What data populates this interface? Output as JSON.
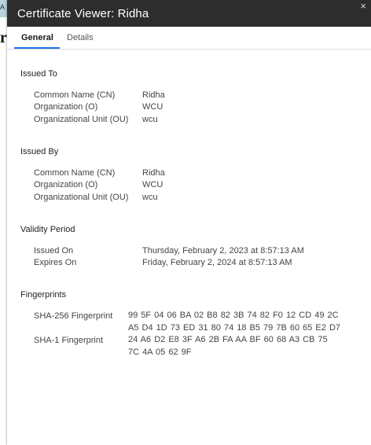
{
  "background": {
    "top_label": "A",
    "glyph": "r"
  },
  "window": {
    "title": "Certificate Viewer: Ridha",
    "close_glyph": "×"
  },
  "tabs": [
    {
      "label": "General",
      "active": true
    },
    {
      "label": "Details",
      "active": false
    }
  ],
  "issued_to": {
    "title": "Issued To",
    "fields": [
      {
        "label": "Common Name (CN)",
        "value": "Ridha"
      },
      {
        "label": "Organization (O)",
        "value": "WCU"
      },
      {
        "label": "Organizational Unit (OU)",
        "value": "wcu"
      }
    ]
  },
  "issued_by": {
    "title": "Issued By",
    "fields": [
      {
        "label": "Common Name (CN)",
        "value": "Ridha"
      },
      {
        "label": "Organization (O)",
        "value": "WCU"
      },
      {
        "label": "Organizational Unit (OU)",
        "value": "wcu"
      }
    ]
  },
  "validity": {
    "title": "Validity Period",
    "fields": [
      {
        "label": "Issued On",
        "value": "Thursday, February 2, 2023 at 8:57:13 AM"
      },
      {
        "label": "Expires On",
        "value": "Friday, February 2, 2024 at 8:57:13 AM"
      }
    ]
  },
  "fingerprints": {
    "title": "Fingerprints",
    "fields": [
      {
        "label": "SHA-256 Fingerprint",
        "value": "99 5F 04 06 BA 02 B8 82 3B 74 82 F0 12 CD 49 2C A5 D4 1D 73 ED 31 80 74 18 B5 79 7B 60 65 E2 D7"
      },
      {
        "label": "SHA-1 Fingerprint",
        "value": "24 A6 D2 E8 3F A6 2B FA AA BF 60 68 A3 CB 75 7C 4A 05 62 9F"
      }
    ]
  }
}
